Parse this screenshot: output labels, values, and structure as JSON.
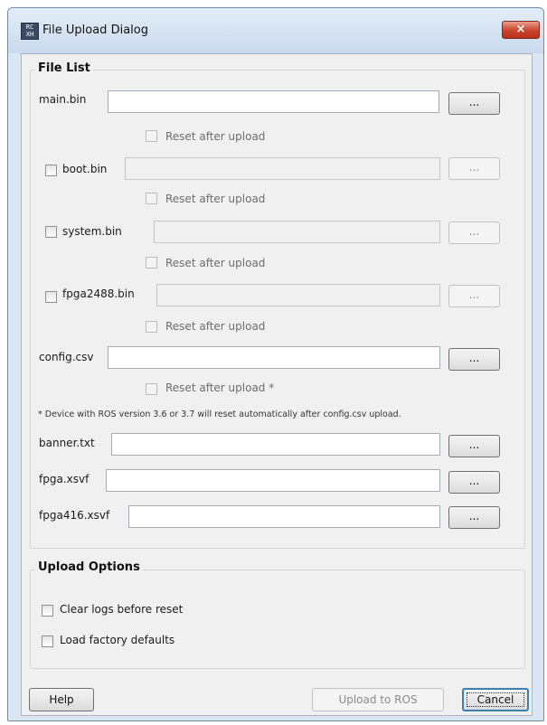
{
  "window": {
    "title": "File Upload Dialog",
    "icon": "RC XH",
    "close": "×"
  },
  "file_list": {
    "heading": "File List",
    "browse_label": "...",
    "reset_label": "Reset after upload",
    "config_reset_label": "Reset after upload *",
    "note": "* Device with ROS version 3.6 or 3.7 will reset automatically after config.csv upload.",
    "files": {
      "main": {
        "name": "main.bin",
        "value": ""
      },
      "boot": {
        "name": "boot.bin",
        "value": ""
      },
      "system": {
        "name": "system.bin",
        "value": ""
      },
      "fpga2488": {
        "name": "fpga2488.bin",
        "value": ""
      },
      "config": {
        "name": "config.csv",
        "value": ""
      },
      "banner": {
        "name": "banner.txt",
        "value": ""
      },
      "fpga": {
        "name": "fpga.xsvf",
        "value": ""
      },
      "fpga416": {
        "name": "fpga416.xsvf",
        "value": ""
      }
    }
  },
  "upload_options": {
    "heading": "Upload Options",
    "clear_logs": "Clear logs before reset",
    "factory_defaults": "Load factory defaults"
  },
  "buttons": {
    "help": "Help",
    "upload": "Upload to ROS",
    "cancel": "Cancel"
  }
}
